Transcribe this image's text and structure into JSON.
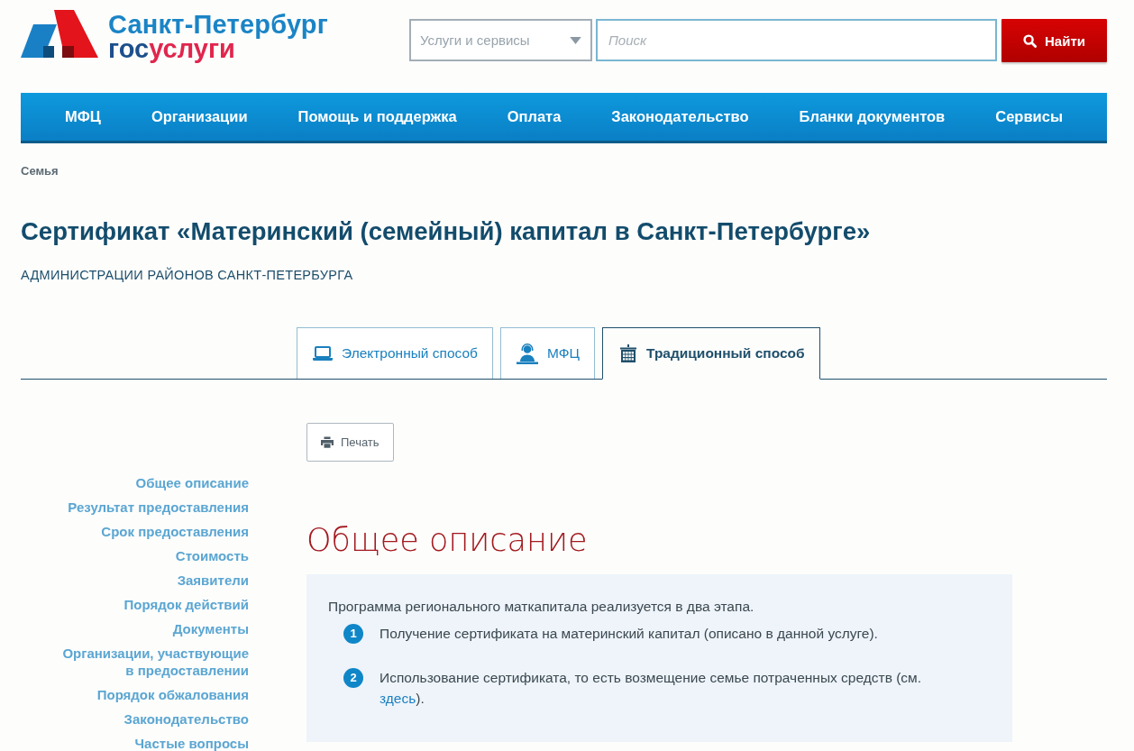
{
  "header": {
    "logo": {
      "city": "Санкт-Петербург",
      "prefix": "гос",
      "suffix": "услуги"
    },
    "category_select": {
      "value": "Услуги и сервисы"
    },
    "search": {
      "placeholder": "Поиск"
    },
    "search_button": {
      "label": "Найти"
    }
  },
  "nav": {
    "items": [
      {
        "label": "МФЦ"
      },
      {
        "label": "Организации"
      },
      {
        "label": "Помощь и поддержка"
      },
      {
        "label": "Оплата"
      },
      {
        "label": "Законодательство"
      },
      {
        "label": "Бланки документов"
      },
      {
        "label": "Сервисы"
      }
    ]
  },
  "breadcrumb": [
    {
      "label": "Семья"
    }
  ],
  "page": {
    "title": "Сертификат «Материнский (семейный) капитал в Санкт-Петербурге»",
    "subtitle": "АДМИНИСТРАЦИИ РАЙОНОВ САНКТ-ПЕТЕРБУРГА"
  },
  "tabs": [
    {
      "label": "Электронный способ",
      "selected": false
    },
    {
      "label": "МФЦ",
      "selected": false
    },
    {
      "label": "Традиционный способ",
      "selected": true
    }
  ],
  "print_button": {
    "label": "Печать"
  },
  "sidebar": {
    "items": [
      {
        "label": "Общее описание"
      },
      {
        "label": "Результат предоставления"
      },
      {
        "label": "Срок предоставления"
      },
      {
        "label": "Стоимость"
      },
      {
        "label": "Заявители"
      },
      {
        "label": "Порядок действий"
      },
      {
        "label": "Документы"
      },
      {
        "label": "Организации, участвующие в предоставлении"
      },
      {
        "label": "Порядок обжалования"
      },
      {
        "label": "Законодательство"
      },
      {
        "label": "Частые вопросы"
      }
    ]
  },
  "section": {
    "heading": "Общее описание",
    "intro": "Программа регионального маткапитала реализуется в два этапа.",
    "steps": [
      {
        "number": "1",
        "text": "Получение сертификата на материнский капитал (описано в данной услуге)."
      },
      {
        "number": "2",
        "text": "Использование сертификата, то есть возмещение семье потраченных средств (см. ",
        "link": "здесь",
        "after": ")."
      }
    ]
  }
}
